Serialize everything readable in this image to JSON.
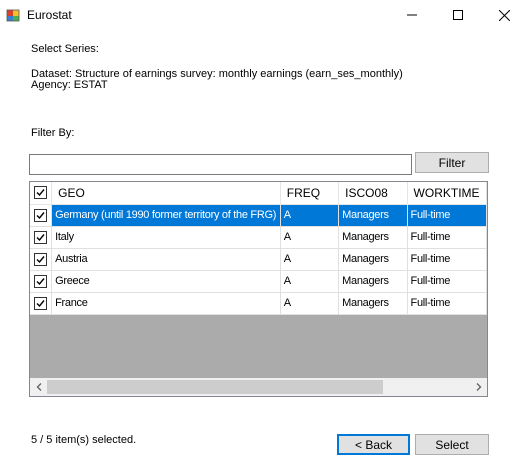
{
  "window": {
    "title": "Eurostat",
    "icon": "eurostat-app-icon",
    "controls": [
      "minimize-icon",
      "maximize-icon",
      "close-icon"
    ]
  },
  "select_series_label": "Select Series:",
  "dataset_line": "Dataset: Structure of earnings survey: monthly earnings (earn_ses_monthly)",
  "agency_line": "Agency: ESTAT",
  "filter": {
    "label": "Filter By:",
    "value": "",
    "button_label": "Filter"
  },
  "grid": {
    "columns": [
      "GEO",
      "FREQ",
      "ISCO08",
      "WORKTIME"
    ],
    "rows": [
      {
        "checked": true,
        "selected": true,
        "cells": [
          "Germany (until 1990 former territory of the FRG)",
          "A",
          "Managers",
          "Full-time"
        ]
      },
      {
        "checked": true,
        "selected": false,
        "cells": [
          "Italy",
          "A",
          "Managers",
          "Full-time"
        ]
      },
      {
        "checked": true,
        "selected": false,
        "cells": [
          "Austria",
          "A",
          "Managers",
          "Full-time"
        ]
      },
      {
        "checked": true,
        "selected": false,
        "cells": [
          "Greece",
          "A",
          "Managers",
          "Full-time"
        ]
      },
      {
        "checked": true,
        "selected": false,
        "cells": [
          "France",
          "A",
          "Managers",
          "Full-time"
        ]
      }
    ]
  },
  "status_text": "5 / 5 item(s) selected.",
  "buttons": {
    "back_label": "< Back",
    "select_label": "Select"
  },
  "colors": {
    "selection": "#0078d7",
    "button_face": "#e1e1e1",
    "grid_background": "#ababab"
  }
}
